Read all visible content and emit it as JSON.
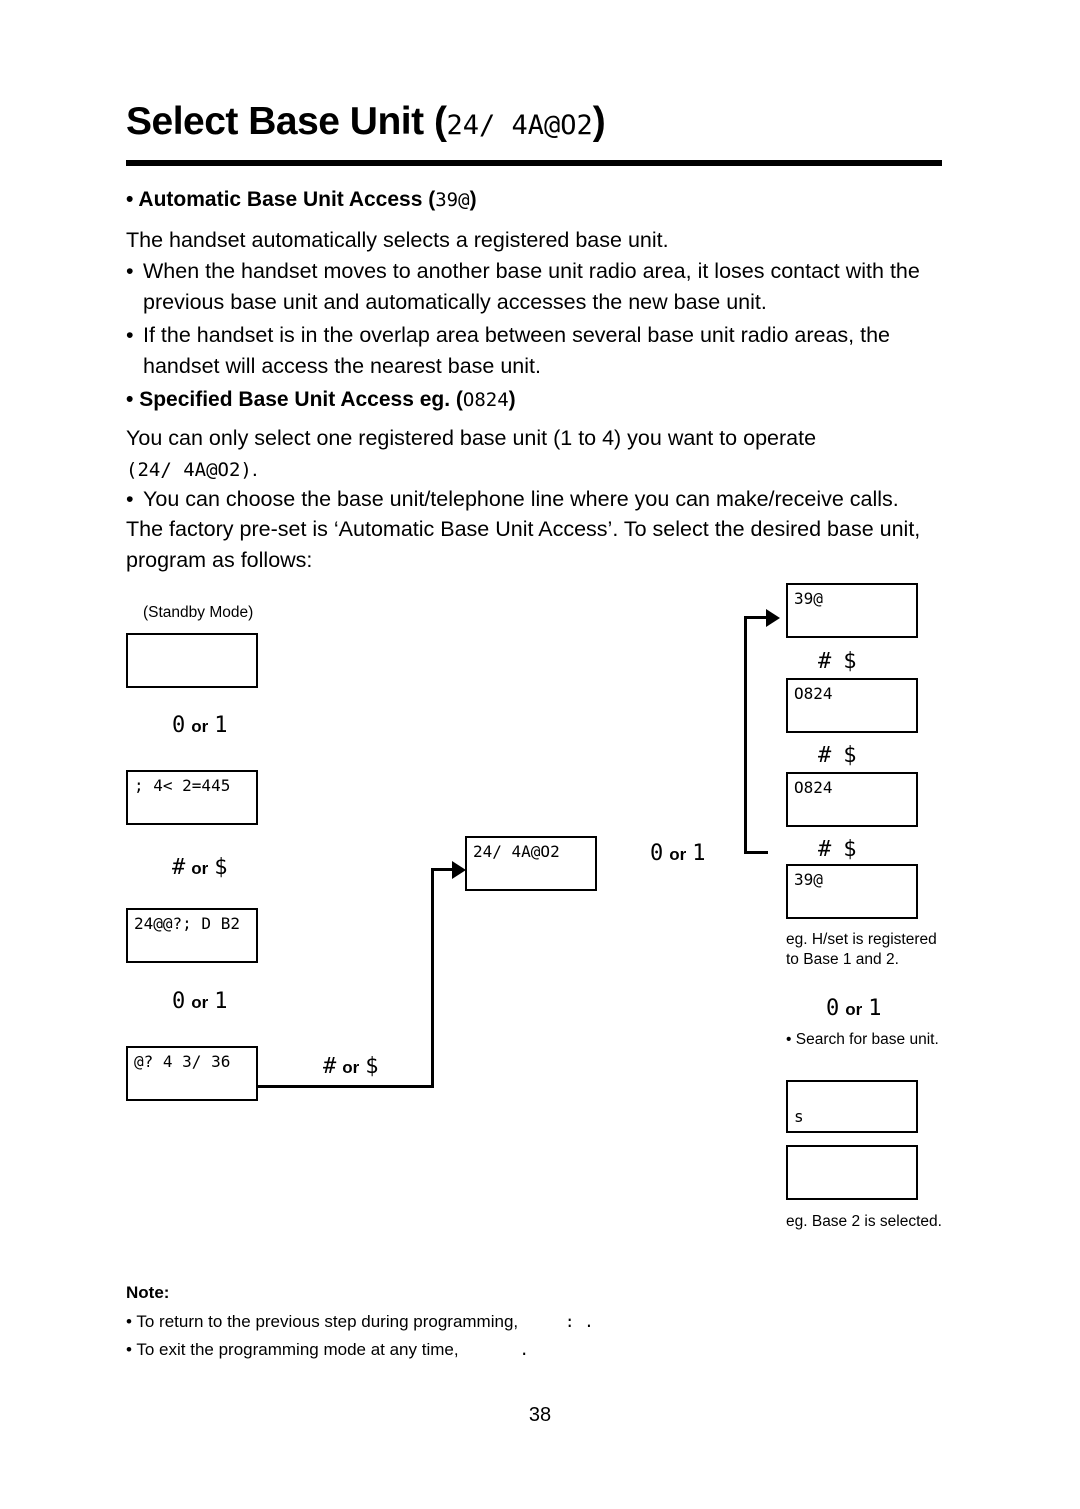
{
  "document": {
    "title_main": "Select Base Unit (",
    "title_lcd": "24/ 4A@O2",
    "title_close": ")",
    "page_number": "38",
    "sections": [
      {
        "heading_bullet": "•",
        "heading_text": "Automatic Base Unit Access (",
        "heading_lcd": "39@",
        "heading_close": ")"
      },
      {
        "heading_bullet": "•",
        "heading_text": "Specified Base Unit Access eg. (",
        "heading_lcd": "O824",
        "heading_close": ")"
      }
    ],
    "paragraphs": {
      "auto_intro": "The handset automatically selects a registered base unit.",
      "auto_b1": "When the handset moves to another base unit radio area, it loses contact with the previous base unit and automatically accesses the new base unit.",
      "auto_b2": "If the handset is in the overlap area between several base unit radio areas, the handset will access the nearest base unit.",
      "spec_l1": "You can only select one registered base unit (1 to 4) you want to operate",
      "spec_l2_lcd": "(24/ 4A@O2)",
      "spec_l2_end": ".",
      "spec_b1": "You can choose the base unit/telephone line where you can make/receive calls.",
      "spec_l3": "The factory pre-set is ‘Automatic Base Unit Access’. To select the desired base unit, program as follows:"
    },
    "note": {
      "label": "Note:",
      "lines": [
        {
          "bullet": "•",
          "text": "To return to the previous step during programming,",
          "key": ":  ."
        },
        {
          "bullet": "•",
          "text": "To exit the programming mode at any time,",
          "key": "."
        }
      ]
    }
  },
  "diagram": {
    "standby_caption": "(Standby Mode)",
    "left_column": {
      "box1": "",
      "key1": {
        "left": "0",
        "or": "or",
        "right": "1"
      },
      "box2": "; 4< 2=445",
      "key2": {
        "left": "#",
        "or": "or",
        "right": "$"
      },
      "box3": "24@@?; D B2",
      "key3": {
        "left": "0",
        "or": "or",
        "right": "1"
      },
      "box4": "@?  4 3/ 36",
      "key4": {
        "left": "#",
        "or": "or",
        "right": "$"
      }
    },
    "middle": {
      "box": "24/ 4A@O2",
      "key": {
        "left": "0",
        "or": "or",
        "right": "1"
      }
    },
    "right_column": {
      "box1": "39@",
      "key1": {
        "left": "#",
        "or": "",
        "right": "$"
      },
      "box2": "O824",
      "key2": {
        "left": "#",
        "or": "",
        "right": "$"
      },
      "box3": "O824",
      "key3": {
        "left": "#",
        "or": "",
        "right": "$"
      },
      "box4": "39@",
      "caption1": "eg. H/set is registered to Base 1 and 2.",
      "key4": {
        "left": "0",
        "or": "or",
        "right": "1"
      },
      "caption2_bullet": "•",
      "caption2": "Search for base unit.",
      "box5": "s",
      "box6": "",
      "caption3": "eg. Base 2 is selected."
    }
  }
}
